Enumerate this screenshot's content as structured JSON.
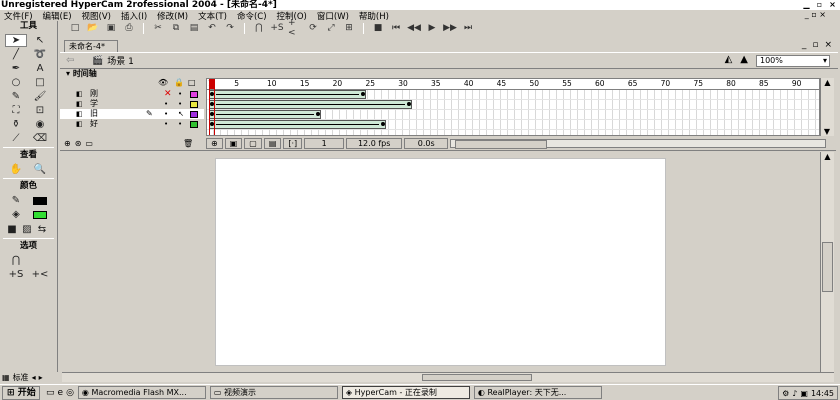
{
  "window": {
    "title": "Unregistered HyperCam 2rofessional 2004 - [未命名-4*]"
  },
  "menu": {
    "items": [
      "文件(F)",
      "编辑(E)",
      "视图(V)",
      "插入(I)",
      "修改(M)",
      "文本(T)",
      "命令(C)",
      "控制(O)",
      "窗口(W)",
      "帮助(H)"
    ],
    "window_controls": "_ ▫ ×"
  },
  "tools": {
    "header": "工具",
    "view_header": "查看",
    "colors_header": "颜色",
    "options_header": "选项",
    "stroke_color": "#000000",
    "fill_color": "#33dd33"
  },
  "document": {
    "tab": "未命名-4*",
    "scene": "场景 1",
    "zoom": "100%"
  },
  "timeline": {
    "header": "时间轴",
    "ruler_ticks": [
      "1",
      "5",
      "10",
      "15",
      "20",
      "25",
      "30",
      "35",
      "40",
      "45",
      "50",
      "55",
      "60",
      "65",
      "70",
      "75",
      "80",
      "85",
      "90"
    ],
    "layers": [
      {
        "name": "刚",
        "color": "#e040e0",
        "selected": false,
        "tween_end_frame": 25
      },
      {
        "name": "学",
        "color": "#e8e840",
        "selected": false,
        "tween_end_frame": 32
      },
      {
        "name": "旧",
        "color": "#a030e0",
        "selected": true,
        "tween_end_frame": 18
      },
      {
        "name": "好",
        "color": "#30c030",
        "selected": false,
        "tween_end_frame": 28
      }
    ],
    "current_frame": "1",
    "fps": "12.0 fps",
    "time": "0.0s"
  },
  "status_tabs": {
    "label": "标准"
  },
  "taskbar": {
    "start": "开始",
    "tasks": [
      {
        "label": "Macromedia Flash MX...",
        "active": false
      },
      {
        "label": "视频演示",
        "active": false
      },
      {
        "label": "HyperCam - 正在录制",
        "active": true
      },
      {
        "label": "RealPlayer: 天下无...",
        "active": false
      }
    ],
    "clock": "14:45"
  }
}
